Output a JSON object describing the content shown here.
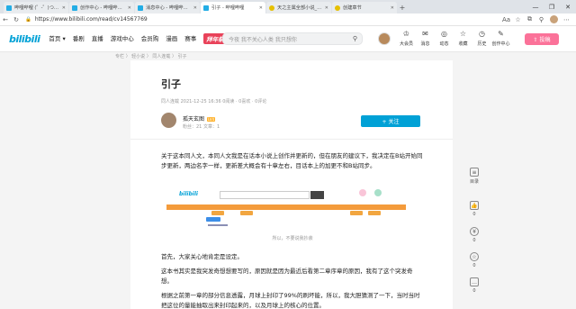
{
  "browser": {
    "tabs": [
      {
        "title": "哔哩哔哩 (゜-゜)つロ 干杯~-bili",
        "favicon": "bili",
        "active": false
      },
      {
        "title": "创作中心 - 哔哩哔哩弹幕视频网",
        "favicon": "bili",
        "active": false
      },
      {
        "title": "消息中心 - 哔哩哔哩弹幕视频网",
        "favicon": "bili",
        "active": false
      },
      {
        "title": "引子 - 哔哩哔哩",
        "favicon": "bili",
        "active": true
      },
      {
        "title": "天之主属全部小说_天之主",
        "favicon": "yellow",
        "active": false
      },
      {
        "title": "创建章节",
        "favicon": "yellow",
        "active": false
      }
    ],
    "new_tab": "+",
    "window_buttons": [
      "—",
      "❐",
      "✕"
    ],
    "url": "https://www.bilibili.com/read/cv14567769"
  },
  "header": {
    "logo": "bilibili",
    "nav": [
      "首页 ▾",
      "番剧",
      "直播",
      "游戏中心",
      "会员购",
      "漫画",
      "赛事",
      "拜年祭会"
    ],
    "search_placeholder": "今夜 我不关心人类 我只想你",
    "icons": [
      {
        "label": "大会员",
        "icon": "crown-icon",
        "glyph": "♔"
      },
      {
        "label": "消息",
        "icon": "message-icon",
        "glyph": "✉"
      },
      {
        "label": "动态",
        "icon": "dynamic-icon",
        "glyph": "◎"
      },
      {
        "label": "收藏",
        "icon": "star-icon",
        "glyph": "☆"
      },
      {
        "label": "历史",
        "icon": "clock-icon",
        "glyph": "◷"
      },
      {
        "label": "创作中心",
        "icon": "bulb-icon",
        "glyph": "✎"
      }
    ],
    "upload": "⇧ 投稿"
  },
  "breadcrumb": "专栏 〉 轻小说 〉 同人连载 〉 引子",
  "article": {
    "title": "引子",
    "meta": "同人连载    2021-12-25 16:36    0阅读 · 0喜欢 · 0评论",
    "author": {
      "name": "孤天玄图",
      "level": "LV4",
      "stats": "粉丝：21    文章：1"
    },
    "follow_label": "+ 关注",
    "para1": "关于这本同人文，本同人文我是在话本小说上创作并更新的，但在朋友的建议下，我决定在B站开始同步更新，两边名字一样，更新差大概会有十章左右，目话本上的加更不和B站同步。",
    "image_caption": "所以，不要说我抄袭",
    "para2": "首先，大家关心地肯定是设定。",
    "para3": "这本书其实是我突发奇想想要写的，原因就是因为最近后看第二章序章的原因，我有了这个突发奇想。",
    "para4": "根据之前第一章的部分信息透露，月球上封印了99%的刷坏能，所以，我大胆猜测了一下，当时当时把这位的量能抽取出来封印起来的，以及月球上的核心的位置。"
  },
  "sidebar": [
    {
      "label": "目录",
      "icon": "catalog-icon",
      "glyph": "≡"
    },
    {
      "label": "0",
      "icon": "like-icon",
      "glyph": "👍"
    },
    {
      "label": "0",
      "icon": "coin-icon",
      "glyph": "¥"
    },
    {
      "label": "0",
      "icon": "favorite-icon",
      "glyph": "☆"
    },
    {
      "label": "0",
      "icon": "comment-icon",
      "glyph": "…"
    }
  ]
}
